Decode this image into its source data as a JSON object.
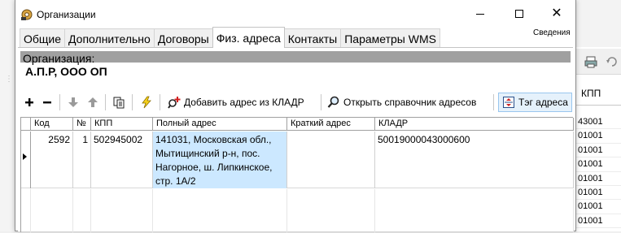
{
  "window": {
    "title": "Организации",
    "info_link": "Сведения",
    "icon": "app-gear-icon",
    "controls": [
      "minimize",
      "maximize",
      "close"
    ]
  },
  "tabs": [
    {
      "label": "Общие",
      "active": false
    },
    {
      "label": "Дополнительно",
      "active": false
    },
    {
      "label": "Договоры",
      "active": false
    },
    {
      "label": "Физ. адреса",
      "active": true
    },
    {
      "label": "Контакты",
      "active": false
    },
    {
      "label": "Параметры WMS",
      "active": false
    }
  ],
  "organization": {
    "label": "Организация:",
    "name": "А.П.Р, ООО ОП"
  },
  "toolbar": {
    "add_icon": "plus-icon",
    "remove_icon": "minus-icon",
    "move_down_icon": "arrow-down-icon",
    "move_up_icon": "arrow-up-icon",
    "copy_icon": "copy-icon",
    "action_icon": "lightning-icon",
    "add_kladr_label": "Добавить адрес из КЛАДР",
    "open_directory_label": "Открыть справочник адресов",
    "tag_label": "Тэг адреса"
  },
  "grid": {
    "columns": [
      "Код",
      "№",
      "КПП",
      "Полный адрес",
      "Краткий адрес",
      "КЛАДР"
    ],
    "rows": [
      {
        "code": "2592",
        "no": "1",
        "kpp": "502945002",
        "full_address": "141031, Московская обл., Мытищинский р-н, пос. Нагорное, ш. Липкинское, стр. 1А/2",
        "short_address": "",
        "kladr": "50019000043000600"
      }
    ]
  },
  "background_app": {
    "column_header": "КПП",
    "values": [
      "43001",
      "01001",
      "01001",
      "01001",
      "01001",
      "01001",
      "01001",
      "01001"
    ]
  }
}
